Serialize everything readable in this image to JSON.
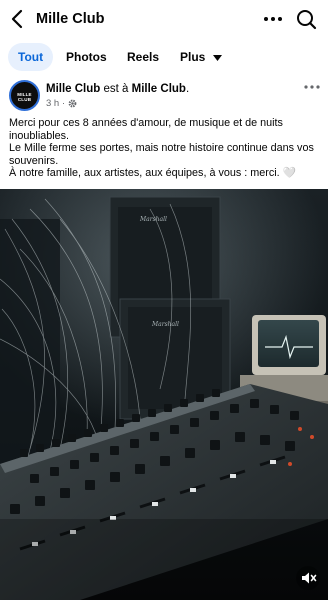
{
  "header": {
    "page_name": "Mille Club"
  },
  "filters": {
    "tabs": [
      {
        "label": "Tout",
        "active": true
      },
      {
        "label": "Photos",
        "active": false
      },
      {
        "label": "Reels",
        "active": false
      },
      {
        "label": "Plus",
        "active": false
      }
    ]
  },
  "post": {
    "avatar_text": "MILLE CLUB",
    "author": "Mille Club",
    "connector": " est à ",
    "location": "Mille Club",
    "time": "3 h",
    "separator": "·",
    "privacy_icon": "settings-gear-icon",
    "text_lines": [
      "Merci pour ces 8 années d'amour, de musique et de nuits inoubliables.",
      "Le Mille ferme ses portes, mais notre histoire continue dans vos souvenirs.",
      "À notre famille, aux artistes, aux équipes, à vous : merci. 🤍"
    ],
    "image_alt": "Studio mixing console with Marshall amplifiers and vintage monitor",
    "image_labels": [
      "Marshall",
      "Marshall"
    ],
    "mute_icon": "speaker-muted-icon"
  },
  "colors": {
    "accent": "#0a66d8",
    "chip_bg": "#e7f0fd",
    "secondary_text": "#65676b",
    "avatar_ring": "#2f6fd8"
  }
}
